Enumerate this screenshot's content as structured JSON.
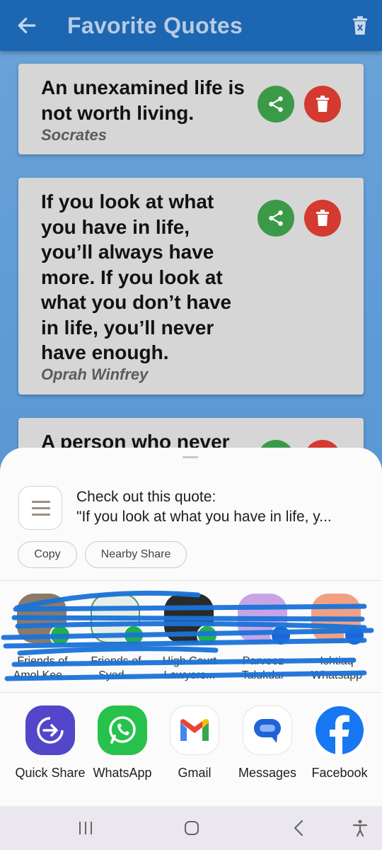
{
  "app_bar": {
    "title": "Favorite Quotes",
    "back_icon": "arrow-left-icon",
    "delete_all_icon": "trash-icon",
    "color": "#1d66b2"
  },
  "quotes": [
    {
      "text": "An unexamined life is not worth living.",
      "author": "Socrates"
    },
    {
      "text": "If you look at what you have in life, you’ll always have more. If you look at what you don’t have in life, you’ll never have enough.",
      "author": "Oprah Winfrey"
    },
    {
      "text": "A person who never",
      "author": ""
    }
  ],
  "share_sheet": {
    "preview_title": "Check out this quote:",
    "preview_text": "\"If you look at what you have in life, y...",
    "copy_label": "Copy",
    "nearby_share_label": "Nearby Share",
    "contacts": [
      {
        "name": "Friends of Amol Kee..."
      },
      {
        "name": "Friends of Syed..."
      },
      {
        "name": "High Court Lawyers..."
      },
      {
        "name": "Parveez Talukdar"
      },
      {
        "name": "Ishtiaq Whatsapp"
      }
    ],
    "apps": [
      {
        "label": "Quick Share",
        "icon": "quick-share-icon"
      },
      {
        "label": "WhatsApp",
        "icon": "whatsapp-icon"
      },
      {
        "label": "Gmail",
        "icon": "gmail-icon"
      },
      {
        "label": "Messages",
        "icon": "messages-icon"
      },
      {
        "label": "Facebook",
        "icon": "facebook-icon"
      }
    ]
  },
  "colors": {
    "share_green": "#3b9a47",
    "delete_red": "#d43a2f",
    "card_grey": "#d6d6d6"
  }
}
